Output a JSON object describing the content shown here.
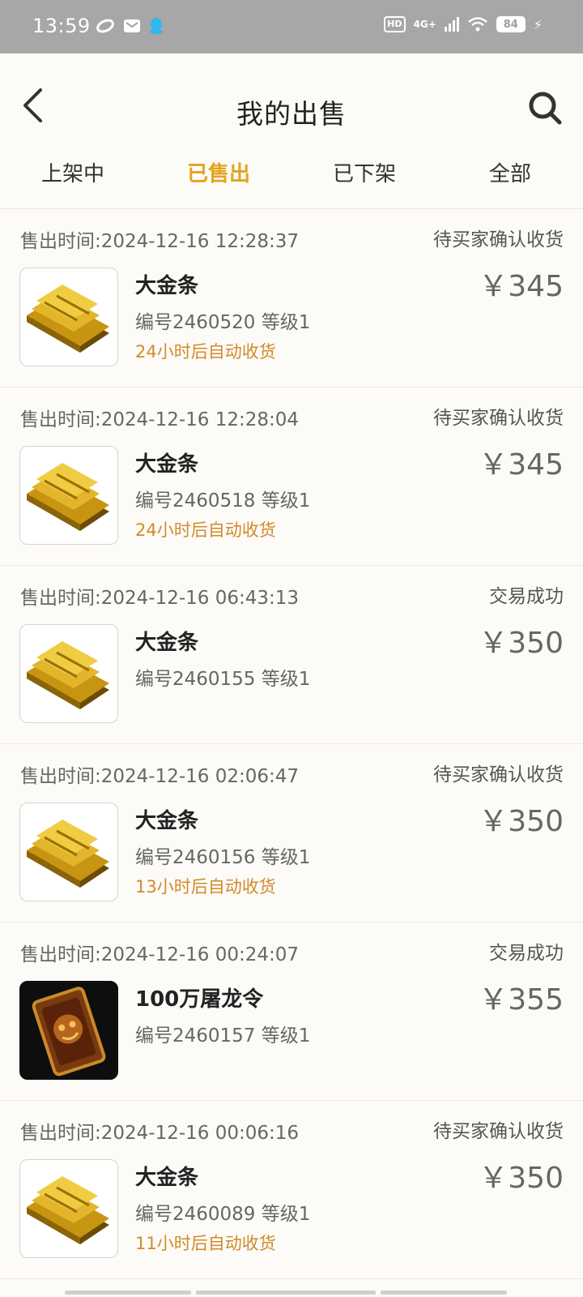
{
  "status_bar": {
    "time": "13:59",
    "left_icons": [
      "link-icon",
      "mail-icon",
      "qq-icon"
    ],
    "hd": "HD",
    "network": "4G+",
    "battery": "84"
  },
  "header": {
    "back_icon": "chevron-left-icon",
    "title": "我的出售",
    "search_icon": "search-icon"
  },
  "tabs": [
    {
      "label": "上架中",
      "active": false
    },
    {
      "label": "已售出",
      "active": true
    },
    {
      "label": "已下架",
      "active": false
    },
    {
      "label": "全部",
      "active": false
    }
  ],
  "colors": {
    "accent": "#e2a521",
    "note": "#d18a2c",
    "background": "#fcfbf7"
  },
  "items": [
    {
      "time": "售出时间:2024-12-16 12:28:37",
      "status": "待买家确认收货",
      "thumb": "gold-bars-icon",
      "name": "大金条",
      "meta": "编号2460520 等级1",
      "note": "24小时后自动收货",
      "price": "￥345"
    },
    {
      "time": "售出时间:2024-12-16 12:28:04",
      "status": "待买家确认收货",
      "thumb": "gold-bars-icon",
      "name": "大金条",
      "meta": "编号2460518 等级1",
      "note": "24小时后自动收货",
      "price": "￥345"
    },
    {
      "time": "售出时间:2024-12-16 06:43:13",
      "status": "交易成功",
      "thumb": "gold-bars-icon",
      "name": "大金条",
      "meta": "编号2460155 等级1",
      "note": "",
      "price": "￥350"
    },
    {
      "time": "售出时间:2024-12-16 02:06:47",
      "status": "待买家确认收货",
      "thumb": "gold-bars-icon",
      "name": "大金条",
      "meta": "编号2460156 等级1",
      "note": "13小时后自动收货",
      "price": "￥350"
    },
    {
      "time": "售出时间:2024-12-16 00:24:07",
      "status": "交易成功",
      "thumb": "dragon-token-icon",
      "name": "100万屠龙令",
      "meta": "编号2460157 等级1",
      "note": "",
      "price": "￥355"
    },
    {
      "time": "售出时间:2024-12-16 00:06:16",
      "status": "待买家确认收货",
      "thumb": "gold-bars-icon",
      "name": "大金条",
      "meta": "编号2460089 等级1",
      "note": "11小时后自动收货",
      "price": "￥350"
    }
  ]
}
